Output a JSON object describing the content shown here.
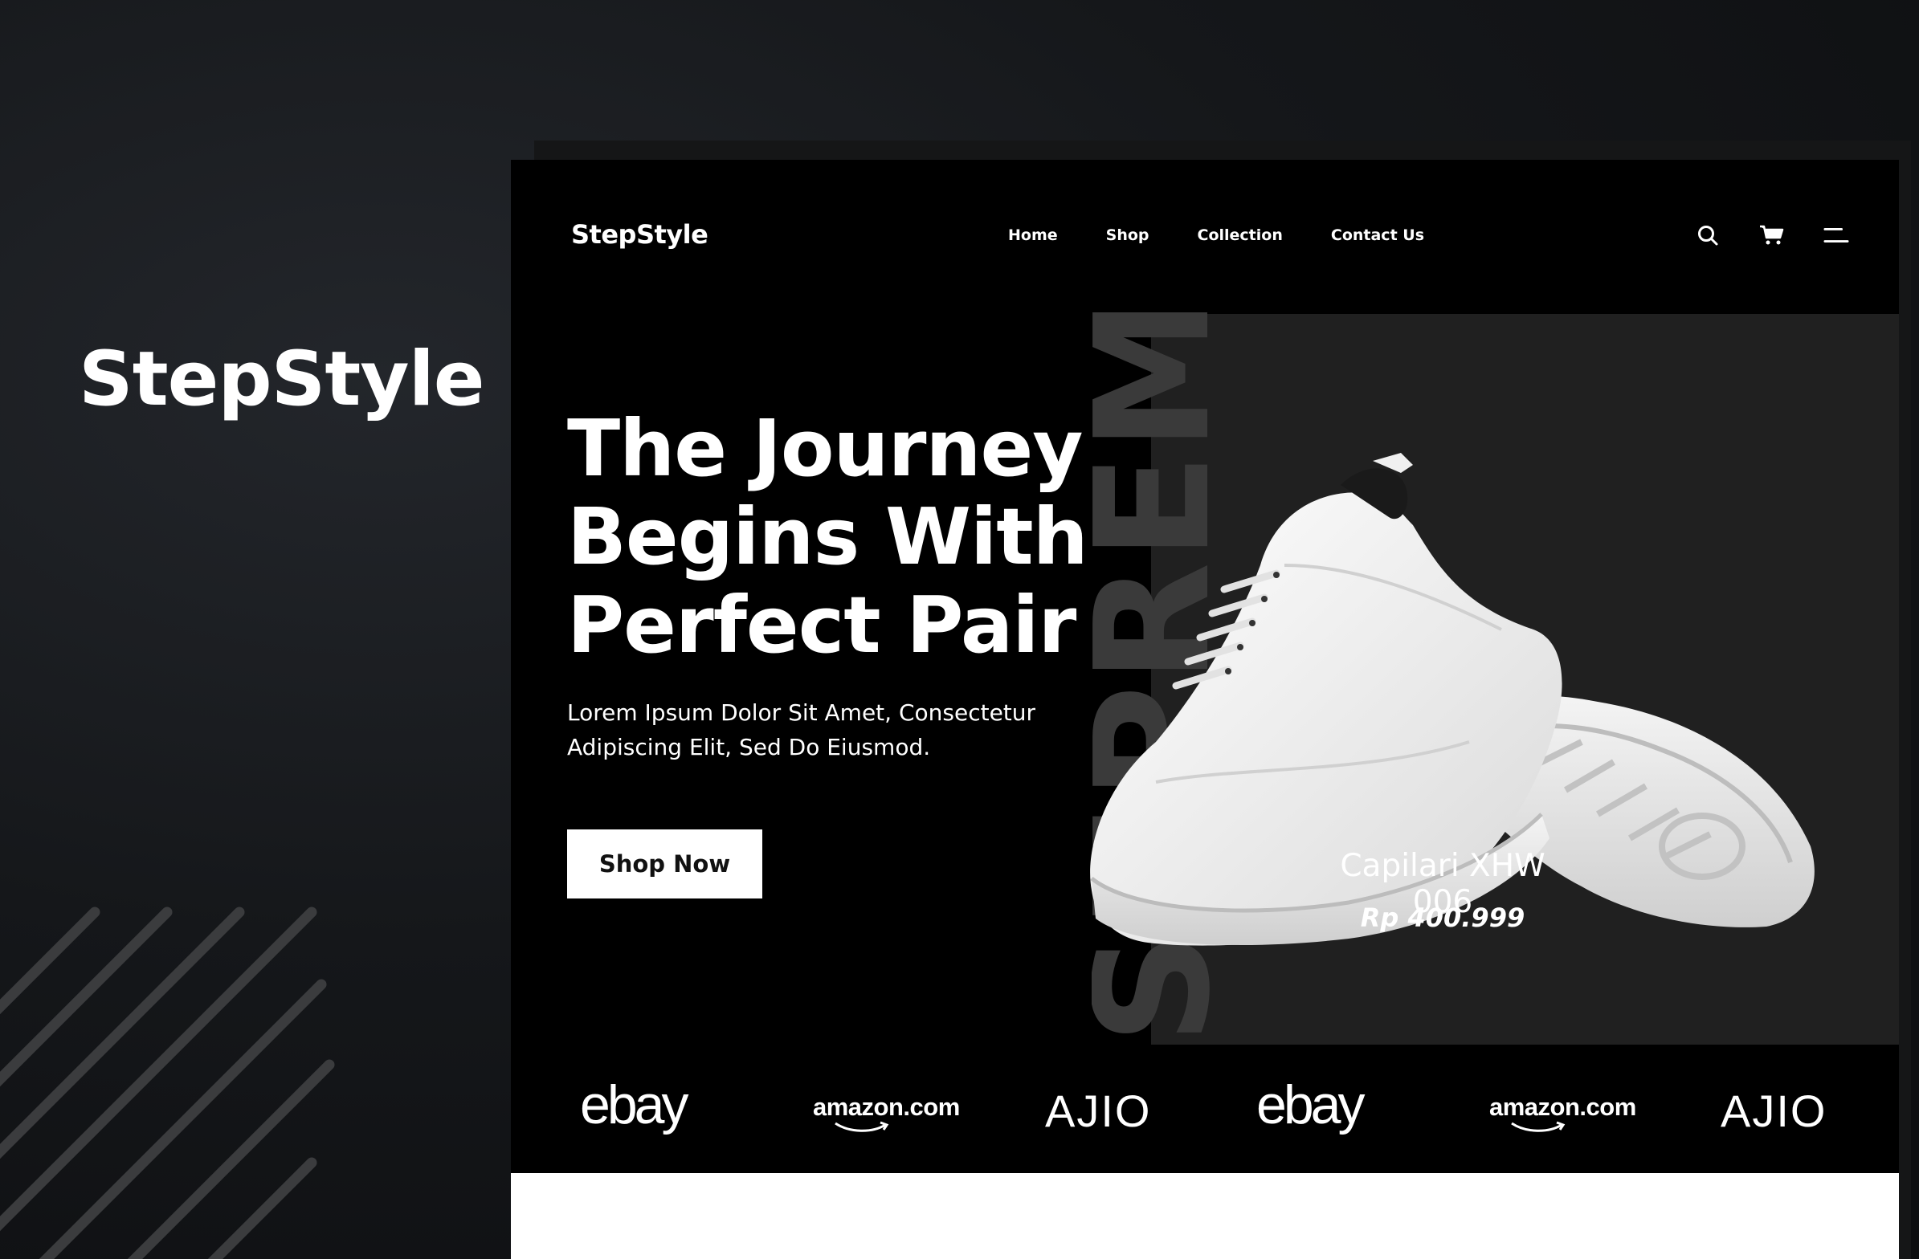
{
  "left_brand": "StepStyle",
  "nav": {
    "logo": "StepStyle",
    "links": [
      "Home",
      "Shop",
      "Collection",
      "Contact Us"
    ],
    "icons": [
      "search-icon",
      "cart-icon",
      "menu-icon"
    ]
  },
  "hero": {
    "title_lines": [
      "The Journey",
      "Begins With",
      "Perfect Pair"
    ],
    "description_lines": [
      "Lorem Ipsum Dolor Sit Amet, Consectetur",
      "Adipiscing Elit, Sed Do Eiusmod."
    ],
    "cta": "Shop Now",
    "vertical_text": "SUPREME"
  },
  "product": {
    "name": "Capilari XHW 006",
    "price": "Rp 400.999"
  },
  "brands": [
    "ebay",
    "amazon.com",
    "AJIO",
    "ebay",
    "amazon.com",
    "AJIO"
  ],
  "colors": {
    "background": "#000000",
    "panel": "#202020",
    "accent": "#ffffff"
  }
}
